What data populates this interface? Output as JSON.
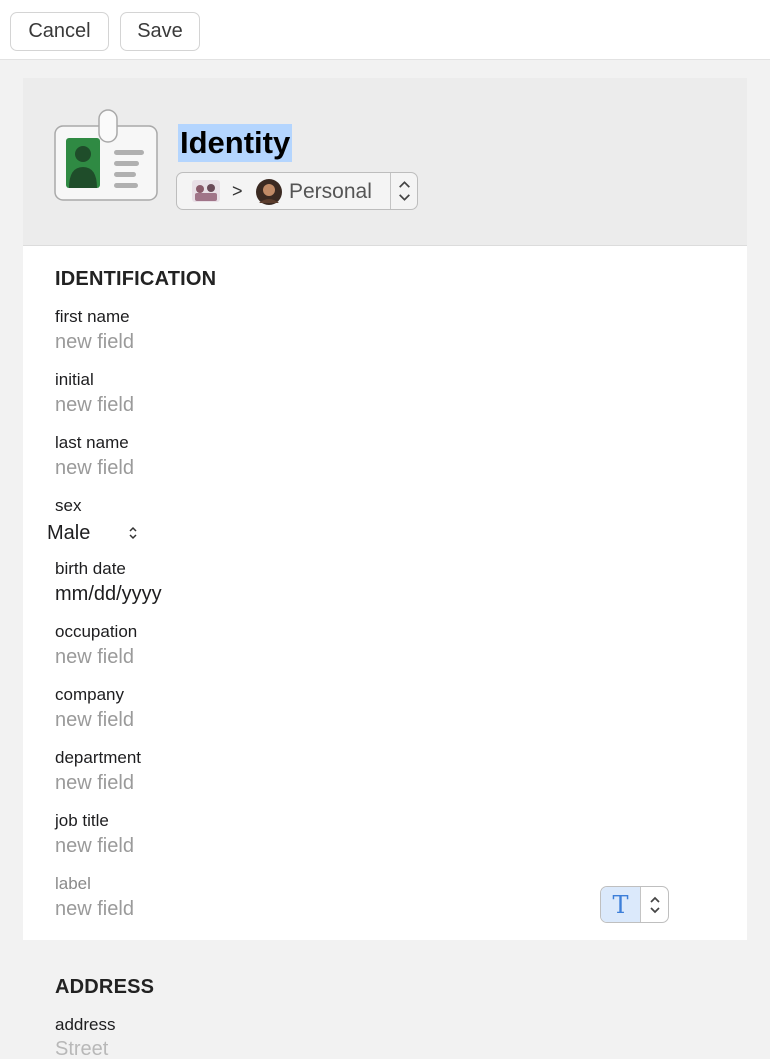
{
  "toolbar": {
    "cancel_label": "Cancel",
    "save_label": "Save"
  },
  "header": {
    "title": "Identity",
    "item_icon": "id-card-icon",
    "vault": {
      "separator": ">",
      "name": "Personal",
      "icon": "vault-thumbnail-icon",
      "avatar": "user-avatar"
    }
  },
  "identification": {
    "heading": "IDENTIFICATION",
    "first_name": {
      "label": "first name",
      "placeholder": "new field"
    },
    "initial": {
      "label": "initial",
      "placeholder": "new field"
    },
    "last_name": {
      "label": "last name",
      "placeholder": "new field"
    },
    "sex": {
      "label": "sex",
      "value": "Male"
    },
    "birth_date": {
      "label": "birth date",
      "value": "mm/dd/yyyy"
    },
    "occupation": {
      "label": "occupation",
      "placeholder": "new field"
    },
    "company": {
      "label": "company",
      "placeholder": "new field"
    },
    "department": {
      "label": "department",
      "placeholder": "new field"
    },
    "job_title": {
      "label": "job title",
      "placeholder": "new field"
    },
    "custom": {
      "label": "label",
      "placeholder": "new field",
      "type_glyph": "T"
    }
  },
  "address": {
    "heading": "ADDRESS",
    "field_label": "address",
    "placeholder": "Street"
  },
  "colors": {
    "title_highlight": "#b4d5fe",
    "type_accent": "#3d7fd9",
    "card_icon_green": "#2f8a43"
  }
}
